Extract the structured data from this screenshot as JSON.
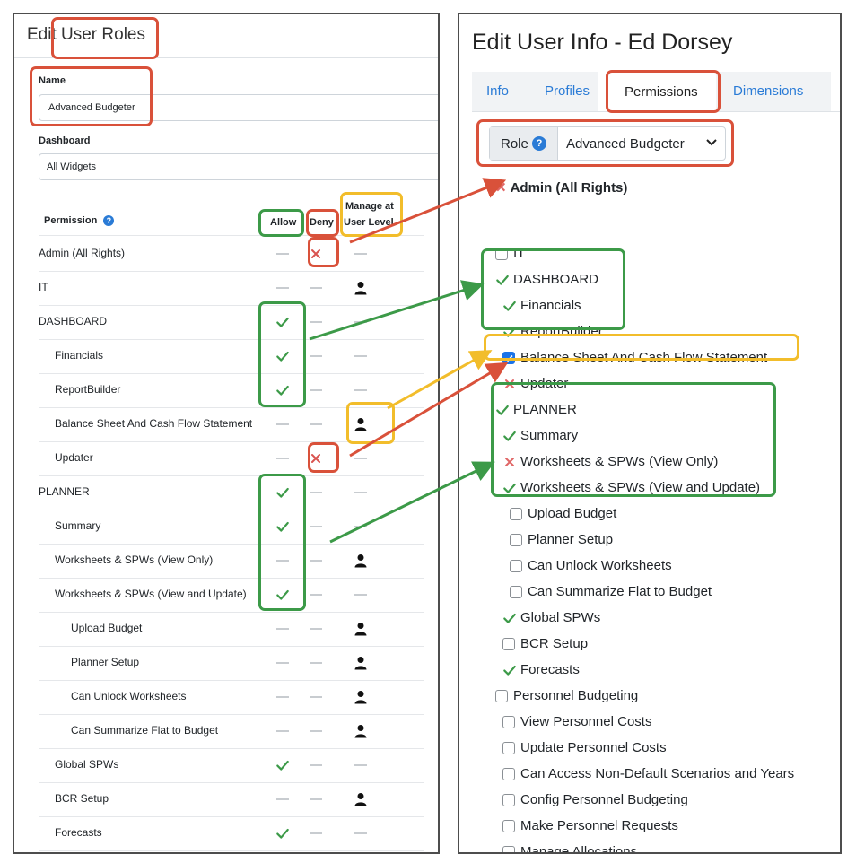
{
  "left_panel": {
    "title": "Edit User Roles",
    "name_label": "Name",
    "name_value": "Advanced Budgeter",
    "dashboard_label": "Dashboard",
    "dashboard_value": "All Widgets",
    "headers": {
      "permission": "Permission",
      "allow": "Allow",
      "deny": "Deny",
      "manage": [
        "Manage at",
        "User Level"
      ]
    },
    "rows": [
      {
        "label": "Admin (All Rights)",
        "indent": 0,
        "allow": "dash",
        "deny": "x",
        "manage": "dash"
      },
      {
        "label": "IT",
        "indent": 0,
        "allow": "dash",
        "deny": "dash",
        "manage": "user"
      },
      {
        "label": "DASHBOARD",
        "indent": 0,
        "allow": "check",
        "deny": "dash",
        "manage": "dash"
      },
      {
        "label": "Financials",
        "indent": 1,
        "allow": "check",
        "deny": "dash",
        "manage": "dash"
      },
      {
        "label": "ReportBuilder",
        "indent": 1,
        "allow": "check",
        "deny": "dash",
        "manage": "dash"
      },
      {
        "label": "Balance Sheet And Cash Flow Statement",
        "indent": 1,
        "allow": "dash",
        "deny": "dash",
        "manage": "user"
      },
      {
        "label": "Updater",
        "indent": 1,
        "allow": "dash",
        "deny": "x",
        "manage": "dash"
      },
      {
        "label": "PLANNER",
        "indent": 0,
        "allow": "check",
        "deny": "dash",
        "manage": "dash"
      },
      {
        "label": "Summary",
        "indent": 1,
        "allow": "check",
        "deny": "dash",
        "manage": "dash"
      },
      {
        "label": "Worksheets & SPWs (View Only)",
        "indent": 1,
        "allow": "dash",
        "deny": "dash",
        "manage": "user"
      },
      {
        "label": "Worksheets & SPWs (View and Update)",
        "indent": 1,
        "allow": "check",
        "deny": "dash",
        "manage": "dash"
      },
      {
        "label": "Upload Budget",
        "indent": 2,
        "allow": "dash",
        "deny": "dash",
        "manage": "user"
      },
      {
        "label": "Planner Setup",
        "indent": 2,
        "allow": "dash",
        "deny": "dash",
        "manage": "user"
      },
      {
        "label": "Can Unlock Worksheets",
        "indent": 2,
        "allow": "dash",
        "deny": "dash",
        "manage": "user"
      },
      {
        "label": "Can Summarize Flat to Budget",
        "indent": 2,
        "allow": "dash",
        "deny": "dash",
        "manage": "user"
      },
      {
        "label": "Global SPWs",
        "indent": 1,
        "allow": "check",
        "deny": "dash",
        "manage": "dash"
      },
      {
        "label": "BCR Setup",
        "indent": 1,
        "allow": "dash",
        "deny": "dash",
        "manage": "user"
      },
      {
        "label": "Forecasts",
        "indent": 1,
        "allow": "check",
        "deny": "dash",
        "manage": "dash"
      }
    ]
  },
  "right_panel": {
    "title": "Edit User Info - Ed Dorsey",
    "tabs": [
      "Info",
      "Profiles",
      "Permissions",
      "Dimensions"
    ],
    "active_tab": "Permissions",
    "role_label": "Role",
    "role_value": "Advanced Budgeter",
    "admin_label": "Admin (All Rights)",
    "items": [
      {
        "label": "IT",
        "indent": 0,
        "state": "unchecked"
      },
      {
        "label": "DASHBOARD",
        "indent": 0,
        "state": "check"
      },
      {
        "label": "Financials",
        "indent": 1,
        "state": "check"
      },
      {
        "label": "ReportBuilder",
        "indent": 1,
        "state": "check"
      },
      {
        "label": "Balance Sheet And Cash Flow Statement",
        "indent": 1,
        "state": "checked"
      },
      {
        "label": "Updater",
        "indent": 1,
        "state": "x"
      },
      {
        "label": "PLANNER",
        "indent": 0,
        "state": "check"
      },
      {
        "label": "Summary",
        "indent": 1,
        "state": "check"
      },
      {
        "label": "Worksheets & SPWs (View Only)",
        "indent": 1,
        "state": "x"
      },
      {
        "label": "Worksheets & SPWs (View and Update)",
        "indent": 1,
        "state": "check"
      },
      {
        "label": "Upload Budget",
        "indent": 2,
        "state": "unchecked"
      },
      {
        "label": "Planner Setup",
        "indent": 2,
        "state": "unchecked"
      },
      {
        "label": "Can Unlock Worksheets",
        "indent": 2,
        "state": "unchecked"
      },
      {
        "label": "Can Summarize Flat to Budget",
        "indent": 2,
        "state": "unchecked"
      },
      {
        "label": "Global SPWs",
        "indent": 1,
        "state": "check"
      },
      {
        "label": "BCR Setup",
        "indent": 1,
        "state": "unchecked"
      },
      {
        "label": "Forecasts",
        "indent": 1,
        "state": "check"
      },
      {
        "label": "Personnel Budgeting",
        "indent": 0,
        "state": "unchecked"
      },
      {
        "label": "View Personnel Costs",
        "indent": 1,
        "state": "unchecked"
      },
      {
        "label": "Update Personnel Costs",
        "indent": 1,
        "state": "unchecked"
      },
      {
        "label": "Can Access Non-Default Scenarios and Years",
        "indent": 1,
        "state": "unchecked"
      },
      {
        "label": "Config Personnel Budgeting",
        "indent": 1,
        "state": "unchecked"
      },
      {
        "label": "Make Personnel Requests",
        "indent": 1,
        "state": "unchecked"
      },
      {
        "label": "Manage Allocations",
        "indent": 1,
        "state": "unchecked"
      }
    ]
  },
  "colors": {
    "check": "#3c9a48",
    "deny": "#d9534f",
    "link": "#2a7bd6",
    "annotation_red": "#d9513a",
    "annotation_green": "#3c9a48",
    "annotation_yellow": "#f2bd2b"
  }
}
